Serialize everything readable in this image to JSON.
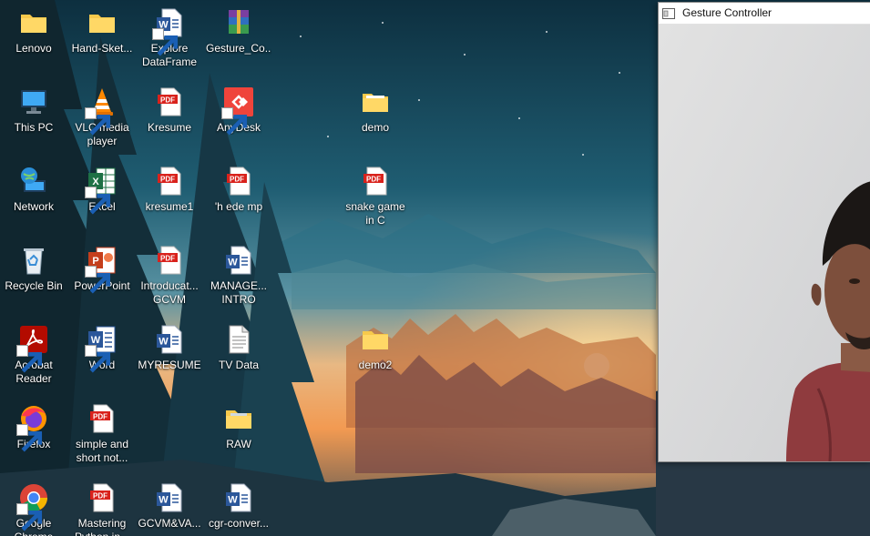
{
  "desktop": {
    "icons": [
      {
        "label": "Lenovo",
        "icon": "folder-icon"
      },
      {
        "label": "Hand-Sket...",
        "icon": "folder-icon"
      },
      {
        "label": "Explore\nDataFrame",
        "icon": "word-document-icon"
      },
      {
        "label": "Gesture_Co...",
        "icon": "winrar-archive-icon"
      },
      {
        "label": "This PC",
        "icon": "computer-icon"
      },
      {
        "label": "VLC media\nplayer",
        "icon": "vlc-cone-icon"
      },
      {
        "label": "Kresume",
        "icon": "pdf-file-icon"
      },
      {
        "label": "AnyDesk",
        "icon": "anydesk-icon"
      },
      {
        "label": "demo",
        "icon": "folder-icon"
      },
      {
        "label": "Network",
        "icon": "network-globe-icon"
      },
      {
        "label": "Excel",
        "icon": "excel-icon"
      },
      {
        "label": "kresume1",
        "icon": "pdf-file-icon"
      },
      {
        "label": "'h ede mp",
        "icon": "pdf-file-icon"
      },
      {
        "label": "snake game\nin C",
        "icon": "pdf-file-icon"
      },
      {
        "label": "Recycle Bin",
        "icon": "recycle-bin-icon"
      },
      {
        "label": "PowerPoint",
        "icon": "powerpoint-icon"
      },
      {
        "label": "Introducat...\nGCVM",
        "icon": "pdf-file-icon"
      },
      {
        "label": "MANAGE...\nINTRO",
        "icon": "word-document-icon"
      },
      {
        "label": "Acrobat\nReader",
        "icon": "acrobat-reader-icon"
      },
      {
        "label": "Word",
        "icon": "word-icon"
      },
      {
        "label": "MYRESUME",
        "icon": "word-document-icon"
      },
      {
        "label": "TV Data",
        "icon": "text-file-icon"
      },
      {
        "label": "demo2",
        "icon": "folder-icon"
      },
      {
        "label": "Firefox",
        "icon": "firefox-icon"
      },
      {
        "label": "simple and\nshort not...",
        "icon": "pdf-file-icon"
      },
      {
        "label": "RAW",
        "icon": "folder-icon"
      },
      {
        "label": "Google\nChrome",
        "icon": "chrome-icon"
      },
      {
        "label": "Mastering\nPython in...",
        "icon": "pdf-file-icon"
      },
      {
        "label": "GCVM&VA...",
        "icon": "word-document-icon"
      },
      {
        "label": "cgr-conver...",
        "icon": "word-document-icon"
      }
    ]
  },
  "gesture_window": {
    "title": "Gesture Controller",
    "app_icon": "window-app-icon",
    "feed_icon": "webcam-feed"
  },
  "colors": {
    "folder": "#f7c94b",
    "pdf_red": "#d9221c",
    "word_blue": "#2b579a",
    "excel_green": "#1e7145",
    "powerpoint_orange": "#c43e1c",
    "chrome_red": "#db4437",
    "chrome_yellow": "#f4b400",
    "chrome_green": "#0f9d58",
    "chrome_blue": "#4285f4"
  }
}
